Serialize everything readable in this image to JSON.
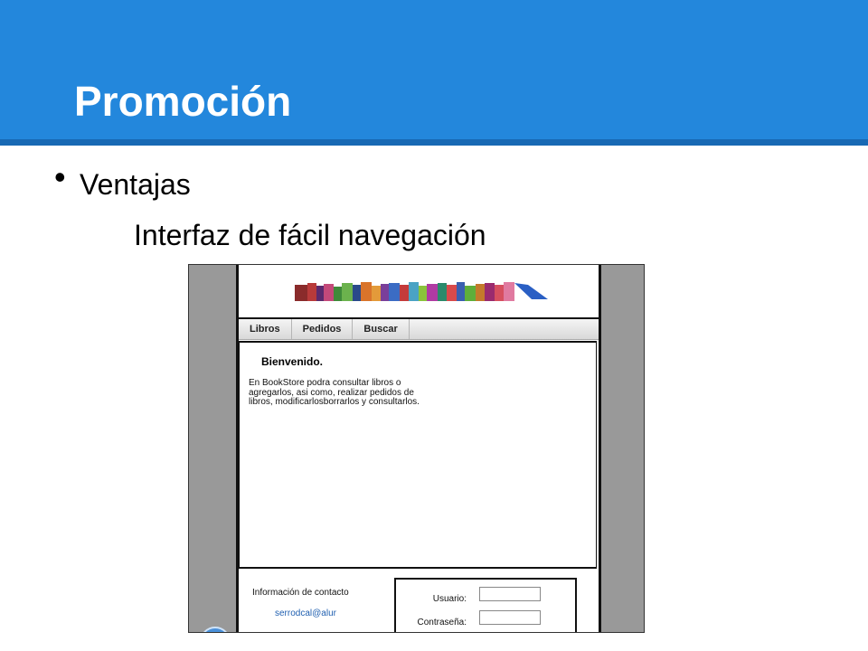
{
  "slide": {
    "title": "Promoción",
    "bullet": "Ventajas",
    "subtext": "Interfaz de fácil navegación"
  },
  "app": {
    "nav": [
      "Libros",
      "Pedidos",
      "Buscar"
    ],
    "welcome": "Bienvenido.",
    "description": "En BookStore podra consultar libros o agregarlos, asi como, realizar pedidos de libros, modificarlosborrarlos y consultarlos.",
    "contact_title": "Información de contacto",
    "contact_email": "serrodcal@alur",
    "login": {
      "user_label": "Usuario:",
      "password_label": "Contraseña:"
    }
  },
  "colors": {
    "header_bg": "#2387dc",
    "header_bottom": "#1869b4",
    "app_side_bg": "#999999"
  }
}
